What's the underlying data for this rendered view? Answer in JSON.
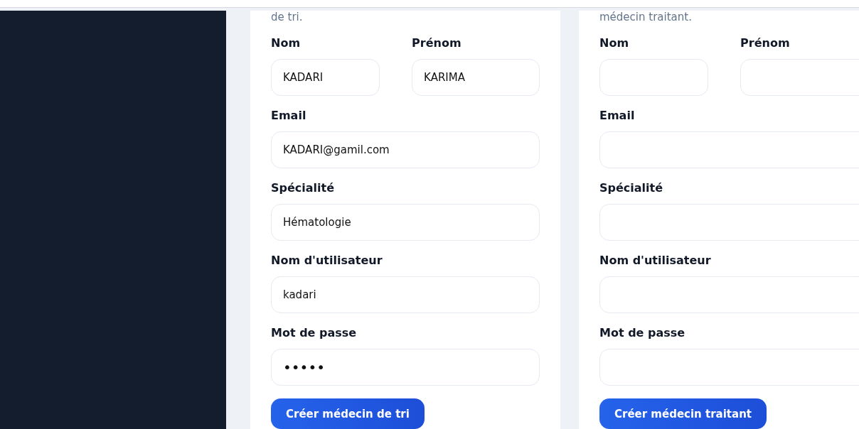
{
  "forms": [
    {
      "intro": "de tri.",
      "fields": [
        {
          "kind": "pair",
          "items": [
            {
              "label": "Nom",
              "value": "KADARI"
            },
            {
              "label": "Prénom",
              "value": "KARIMA"
            }
          ]
        },
        {
          "kind": "single",
          "items": [
            {
              "label": "Email",
              "value": "KADARI@gamil.com"
            }
          ]
        },
        {
          "kind": "single",
          "items": [
            {
              "label": "Spécialité",
              "value": "Hématologie"
            }
          ]
        },
        {
          "kind": "single",
          "items": [
            {
              "label": "Nom d'utilisateur",
              "value": "kadari"
            }
          ]
        },
        {
          "kind": "password",
          "items": [
            {
              "label": "Mot de passe",
              "value": "•••••"
            }
          ]
        }
      ],
      "button": "Créer médecin de tri"
    },
    {
      "intro": "médecin traitant.",
      "fields": [
        {
          "kind": "pair",
          "items": [
            {
              "label": "Nom"
            },
            {
              "label": "Prénom"
            }
          ]
        },
        {
          "kind": "single",
          "items": [
            {
              "label": "Email"
            }
          ]
        },
        {
          "kind": "single",
          "items": [
            {
              "label": "Spécialité"
            }
          ]
        },
        {
          "kind": "single",
          "items": [
            {
              "label": "Nom d'utilisateur"
            }
          ]
        },
        {
          "kind": "password",
          "items": [
            {
              "label": "Mot de passe"
            }
          ]
        }
      ],
      "button": "Créer médecin traitant"
    }
  ]
}
